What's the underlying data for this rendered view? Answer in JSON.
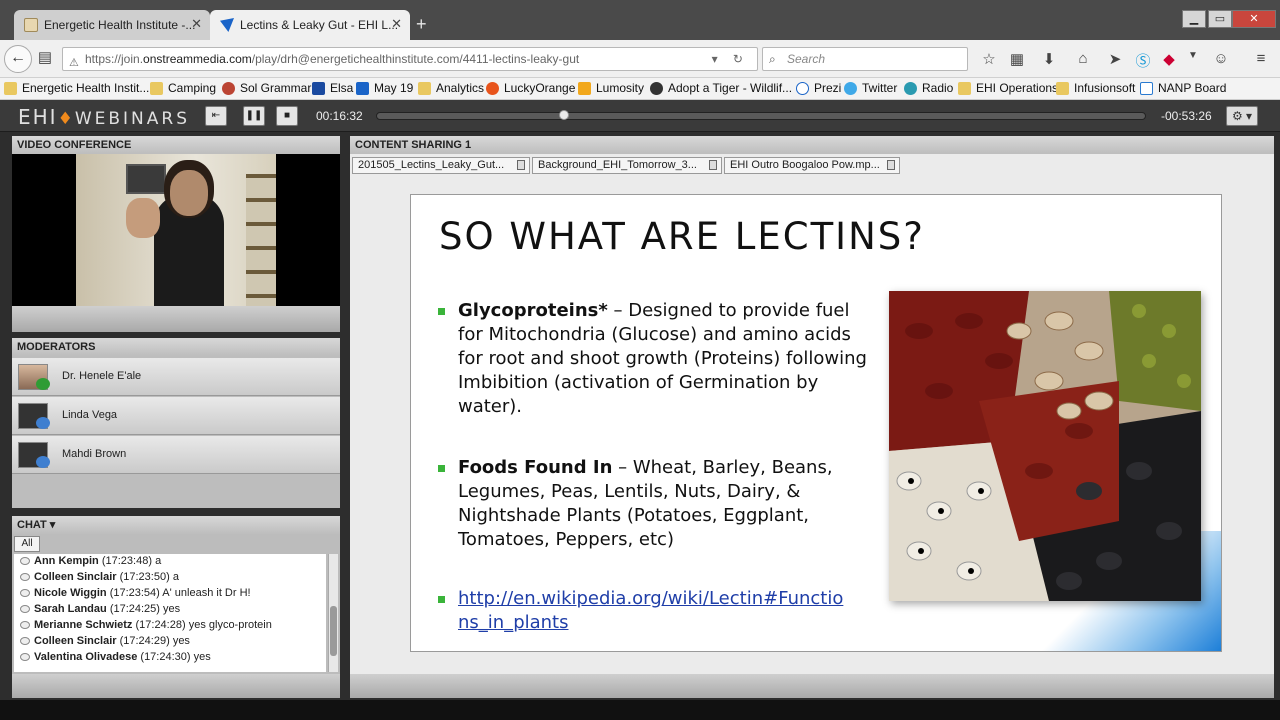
{
  "browser": {
    "tabs": [
      {
        "title": "Energetic Health Institute -..."
      },
      {
        "title": "Lectins & Leaky Gut - EHI L..."
      }
    ],
    "url_prefix": "https://join.",
    "url_host": "onstreammedia.com",
    "url_path": "/play/drh@energetichealthinstitute.com/4411-lectins-leaky-gut",
    "search_placeholder": "Search",
    "bookmarks": [
      "Energetic Health Instit...",
      "Camping",
      "Sol Grammar",
      "Elsa",
      "May 19",
      "Analytics",
      "LuckyOrange",
      "Lumosity",
      "Adopt a Tiger - Wildlif...",
      "Prezi",
      "Twitter",
      "Radio",
      "EHI Operations",
      "Infusionsoft",
      "NANP Board"
    ]
  },
  "player": {
    "logo_main": "EHI",
    "logo_sub": "WEBINARS",
    "time_elapsed": "00:16:32",
    "time_remaining": "-00:53:26",
    "progress_fraction": 0.24
  },
  "panels": {
    "video_title": "VIDEO CONFERENCE",
    "moderators_title": "MODERATORS",
    "chat_title": "CHAT ▾",
    "chat_tab": "All",
    "content_title": "CONTENT SHARING 1"
  },
  "moderators": [
    {
      "name": "Dr. Henele E'ale"
    },
    {
      "name": "Linda Vega"
    },
    {
      "name": "Mahdi Brown"
    }
  ],
  "chat": [
    {
      "who": "Ann Kempin",
      "time": "(17:23:48)",
      "msg": "a"
    },
    {
      "who": "Colleen Sinclair",
      "time": "(17:23:50)",
      "msg": "a"
    },
    {
      "who": "Nicole Wiggin",
      "time": "(17:23:54)",
      "msg": "A' unleash it Dr H!"
    },
    {
      "who": "Sarah Landau",
      "time": "(17:24:25)",
      "msg": "yes"
    },
    {
      "who": "Merianne Schwietz",
      "time": "(17:24:28)",
      "msg": "yes glyco-protein"
    },
    {
      "who": "Colleen Sinclair",
      "time": "(17:24:29)",
      "msg": "yes"
    },
    {
      "who": "Valentina Olivadese",
      "time": "(17:24:30)",
      "msg": "yes"
    }
  ],
  "files": [
    "201505_Lectins_Leaky_Gut...",
    "Background_EHI_Tomorrow_3...",
    "EHI Outro Boogaloo Pow.mp..."
  ],
  "slide": {
    "title": "SO WHAT ARE LECTINS?",
    "bullet1_bold": "Glycoproteins*",
    "bullet1_text": " – Designed to provide fuel for Mitochondria (Glucose) and amino acids for root and shoot growth (Proteins) following Imbibition (activation of Germination by water).",
    "bullet2_bold": "Foods Found In",
    "bullet2_text": " – Wheat, Barley, Beans, Legumes, Peas, Lentils, Nuts, Dairy, & Nightshade Plants (Potatoes, Eggplant, Tomatoes, Peppers, etc)",
    "link": "http://en.wikipedia.org/wiki/Lectin#Functions_in_plants"
  },
  "colors": {
    "accent_flame": "#f08a1c",
    "bullet_green": "#3ab43a",
    "link_blue": "#1f3ea8"
  }
}
